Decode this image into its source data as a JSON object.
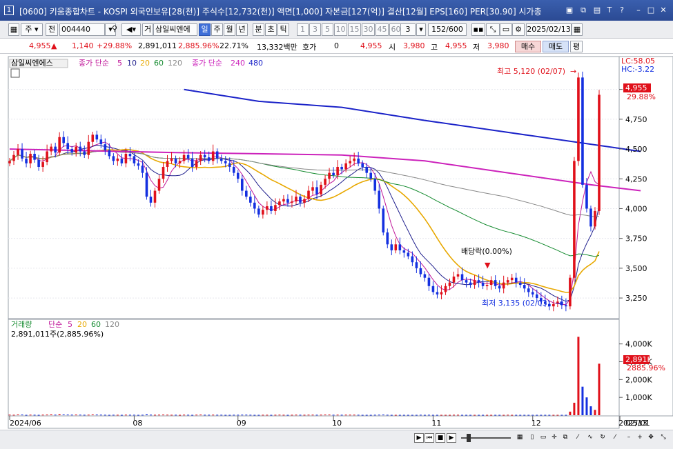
{
  "window": {
    "number": "1",
    "title": "[0600] 키움종합차트 - KOSPI 외국인보유[28(천)] 주식수[12,732(천)] 액면[1,000] 자본금[127(억)] 결산[12월] EPS[160] PER[30.90] 시가총"
  },
  "toolbar": {
    "type_label": "주",
    "prev_label": "전",
    "code": "004440",
    "trade_label": "거",
    "stock_name": "삼일씨엔에",
    "periods": [
      "일",
      "주",
      "월",
      "년",
      "분",
      "초",
      "틱"
    ],
    "selected_period": "일",
    "numbers": [
      "1",
      "3",
      "5",
      "10",
      "15",
      "30",
      "45",
      "60"
    ],
    "count_value": "3",
    "bars": "152",
    "bars_total": "/600",
    "date": "2025/02/13"
  },
  "quote": {
    "price": "4,955",
    "change": "1,140",
    "change_pct": "+29.88%",
    "volume": "2,891,011",
    "volume_pct": "2,885.96%",
    "turnover": "22.71%",
    "amount": "13,332백만",
    "hoga_label": "호가",
    "hoga_value": "0",
    "hoga_price": "4,955",
    "open_label": "시",
    "open": "3,980",
    "high_label": "고",
    "high": "4,955",
    "low_label": "저",
    "low": "3,980",
    "buy_label": "매수",
    "sell_label": "매도",
    "eval_label": "평"
  },
  "legend": {
    "stock": "삼일씨엔에스",
    "ma_label": "종가 단순",
    "ma_periods": [
      "5",
      "10",
      "20",
      "60",
      "120"
    ],
    "ma2_label": "종가 단순",
    "ma2_periods": [
      "240",
      "480"
    ]
  },
  "annotations": {
    "high": "최고 5,120 (02/07)",
    "low": "최저 3,135 (02/03)",
    "dividend": "배당락(0.00%)",
    "lc": "LC:58.05",
    "hc": "HC:-3.22",
    "current_price": "4,955",
    "current_pct": "29.88%"
  },
  "volume_panel": {
    "title": "거래량",
    "ma_label": "단순",
    "ma_periods": [
      "5",
      "20",
      "60",
      "120"
    ],
    "value_text": "2,891,011주(2,885.96%)",
    "current": "2,891K",
    "current_pct": "2885.96%"
  },
  "colors": {
    "up": "#e0101a",
    "down": "#1430e0",
    "ma5": "#c0189a",
    "ma10": "#1d1d8c",
    "ma20": "#e8a800",
    "ma60": "#138a2e",
    "ma120": "#888888",
    "ma240": "#cc22bb",
    "ma480": "#1a22c8"
  },
  "chart_data": {
    "type": "candlestick",
    "x_ticks": [
      "2024/06",
      "08",
      "09",
      "10",
      "11",
      "12",
      "2025/01",
      "02",
      "02/13"
    ],
    "y_ticks": [
      3250,
      3500,
      3750,
      4000,
      4250,
      4500,
      4750,
      5000
    ],
    "y_tick_labels": [
      "3,250",
      "3,500",
      "3,750",
      "4,000",
      "4,250",
      "4,500",
      "4,750",
      "5,000"
    ],
    "ylim": [
      3100,
      5200
    ],
    "close": [
      4400,
      4450,
      4500,
      4420,
      4380,
      4460,
      4410,
      4350,
      4390,
      4480,
      4520,
      4470,
      4600,
      4550,
      4500,
      4470,
      4520,
      4480,
      4450,
      4560,
      4620,
      4580,
      4540,
      4490,
      4440,
      4400,
      4420,
      4380,
      4460,
      4440,
      4380,
      4360,
      4300,
      4100,
      4050,
      4150,
      4250,
      4350,
      4400,
      4420,
      4380,
      4400,
      4450,
      4420,
      4350,
      4400,
      4450,
      4430,
      4400,
      4480,
      4420,
      4400,
      4380,
      4350,
      4300,
      4250,
      4150,
      4100,
      4050,
      4000,
      3950,
      3990,
      4020,
      3980,
      4030,
      4060,
      4080,
      4050,
      4060,
      4100,
      4050,
      4080,
      4150,
      4180,
      4120,
      4200,
      4250,
      4300,
      4280,
      4350,
      4330,
      4380,
      4400,
      4420,
      4380,
      4350,
      4300,
      4250,
      4150,
      4000,
      3800,
      3700,
      3650,
      3700,
      3650,
      3630,
      3600,
      3550,
      3500,
      3450,
      3420,
      3350,
      3300,
      3280,
      3300,
      3350,
      3380,
      3430,
      3450,
      3400,
      3380,
      3360,
      3400,
      3380,
      3350,
      3360,
      3400,
      3350,
      3330,
      3380,
      3400,
      3420,
      3380,
      3360,
      3330,
      3300,
      3280,
      3250,
      3220,
      3200,
      3180,
      3200,
      3220,
      3190,
      3180,
      3420,
      4400,
      5100,
      4200,
      4000,
      3850,
      3980,
      4955
    ],
    "volume_k": [
      30,
      25,
      40,
      35,
      20,
      30,
      25,
      20,
      30,
      35,
      45,
      30,
      55,
      40,
      35,
      30,
      35,
      30,
      25,
      30,
      40,
      35,
      30,
      25,
      20,
      25,
      25,
      20,
      30,
      25,
      25,
      20,
      25,
      50,
      30,
      25,
      30,
      35,
      30,
      25,
      25,
      20,
      30,
      25,
      20,
      30,
      35,
      25,
      25,
      30,
      25,
      25,
      20,
      20,
      25,
      25,
      30,
      30,
      25,
      20,
      20,
      25,
      25,
      20,
      25,
      30,
      25,
      20,
      25,
      30,
      25,
      25,
      30,
      30,
      25,
      30,
      35,
      35,
      25,
      30,
      25,
      30,
      30,
      30,
      25,
      20,
      20,
      20,
      25,
      30,
      35,
      25,
      20,
      20,
      20,
      20,
      20,
      20,
      20,
      25,
      20,
      25,
      20,
      20,
      20,
      20,
      20,
      25,
      25,
      20,
      20,
      20,
      20,
      20,
      20,
      20,
      20,
      20,
      20,
      20,
      25,
      20,
      20,
      20,
      20,
      20,
      20,
      20,
      20,
      20,
      20,
      20,
      20,
      20,
      20,
      200,
      700,
      4400,
      1600,
      1000,
      500,
      300,
      2891
    ],
    "ma480": [
      {
        "i": 42,
        "v": 5000
      },
      {
        "i": 60,
        "v": 4900
      },
      {
        "i": 80,
        "v": 4850
      },
      {
        "i": 100,
        "v": 4740
      },
      {
        "i": 120,
        "v": 4640
      },
      {
        "i": 140,
        "v": 4540
      },
      {
        "i": 152,
        "v": 4480
      }
    ],
    "ma240": [
      {
        "i": 0,
        "v": 4500
      },
      {
        "i": 40,
        "v": 4470
      },
      {
        "i": 80,
        "v": 4450
      },
      {
        "i": 100,
        "v": 4400
      },
      {
        "i": 120,
        "v": 4300
      },
      {
        "i": 140,
        "v": 4200
      },
      {
        "i": 152,
        "v": 4150
      }
    ]
  }
}
